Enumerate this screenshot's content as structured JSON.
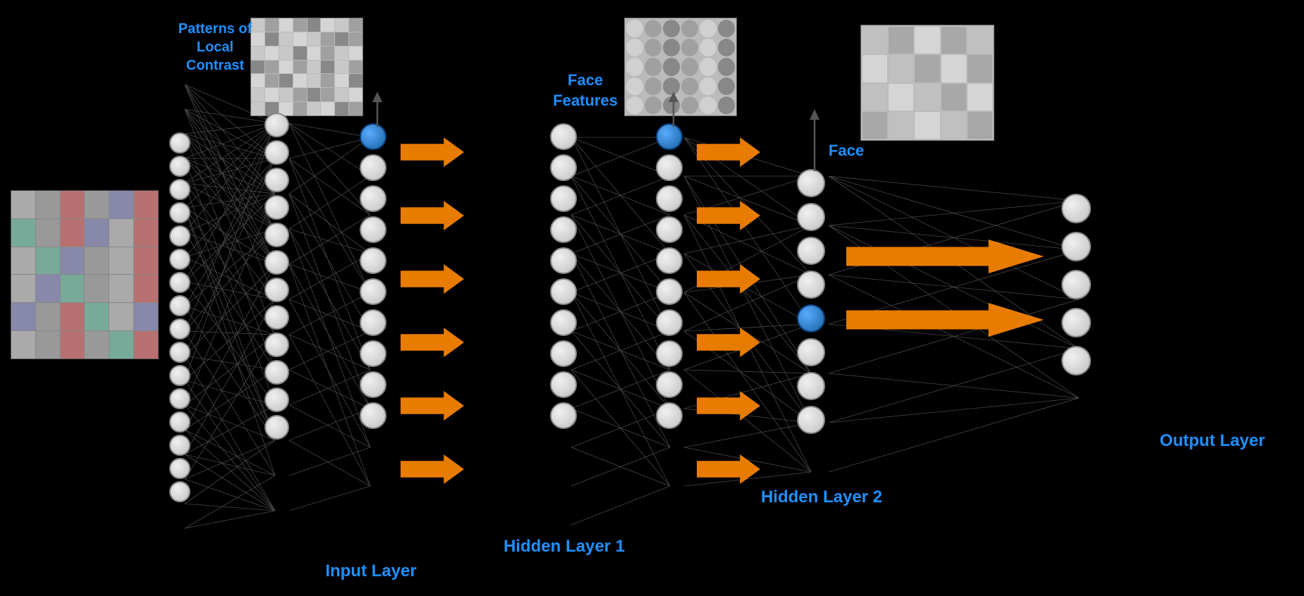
{
  "labels": {
    "patterns": "Patterns of Local\nContrast",
    "face_features": "Face\nFeatures",
    "face": "Face",
    "input_layer": "Input Layer",
    "hidden_layer_1": "Hidden Layer 1",
    "hidden_layer_2": "Hidden Layer 2",
    "output_layer": "Output Layer"
  },
  "colors": {
    "background": "#000000",
    "label_blue": "#1e90ff",
    "arrow_orange": "#e87c00",
    "neuron_light": "#d0d0d0",
    "neuron_dark": "#a0a0a0",
    "blue_neuron": "#1560a0"
  },
  "layers": {
    "input_neurons": 16,
    "hidden1_col1_neurons": 12,
    "hidden1_col2_neurons": 10,
    "hidden2_col1_neurons": 10,
    "hidden2_col2_neurons": 10,
    "hl2_neurons": 8,
    "output_neurons": 5
  }
}
